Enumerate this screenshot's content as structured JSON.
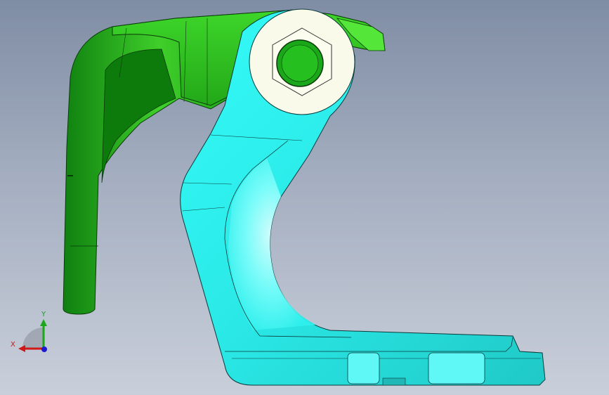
{
  "viewport": {
    "background_top": "#7f8da4",
    "background_bottom": "#c9cfda"
  },
  "parts": [
    {
      "id": "lever-arm",
      "color": "#2eb81c",
      "shade": "#128a0a"
    },
    {
      "id": "clamp-body",
      "color": "#2ff5f2",
      "shade": "#1fc8c6"
    },
    {
      "id": "hex-nut",
      "color": "#fafaea"
    },
    {
      "id": "pivot-pin",
      "color": "#1aa81a"
    }
  ],
  "triad": {
    "x_label": "X",
    "y_label": "Y",
    "x_color": "#d01818",
    "y_color": "#1aa81a",
    "z_color": "#1a1ad0"
  }
}
